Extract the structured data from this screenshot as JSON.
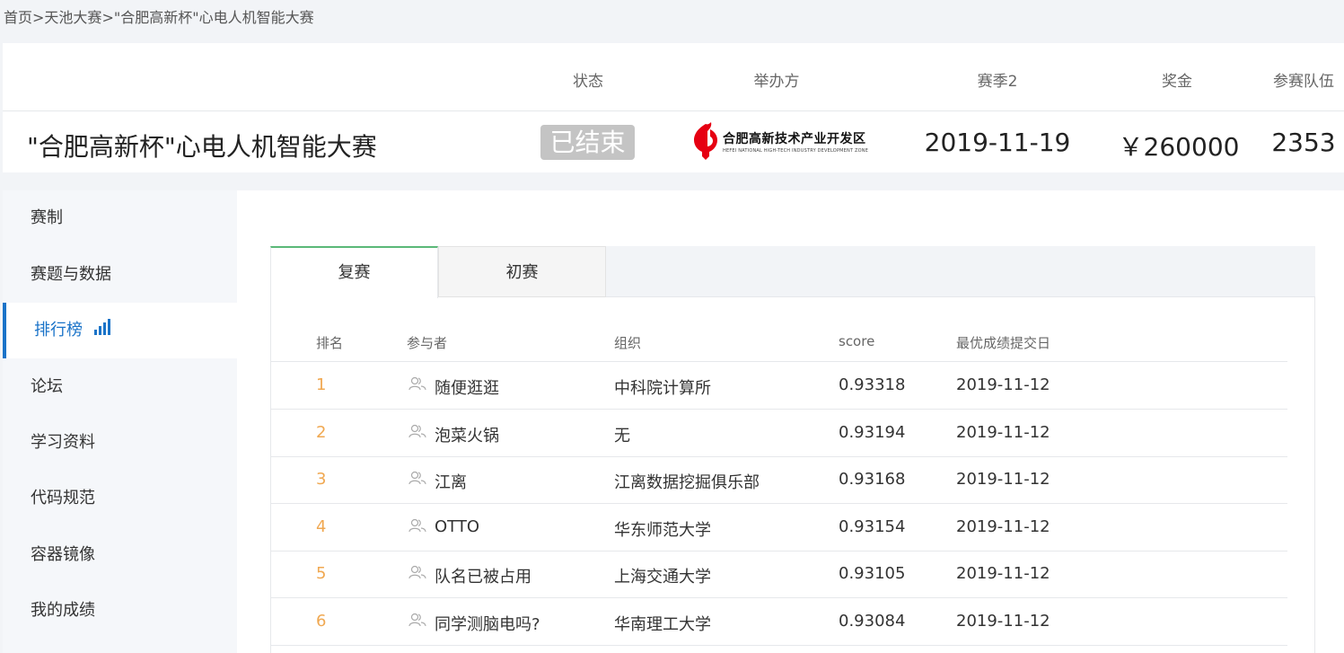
{
  "breadcrumb": {
    "home": "首页",
    "sep1": ">",
    "tianchi": "天池大赛",
    "sep2": ">",
    "current": "\"合肥高新杯\"心电人机智能大赛"
  },
  "header": {
    "labels": {
      "status": "状态",
      "organizer": "举办方",
      "season": "赛季2",
      "prize": "奖金",
      "teams": "参赛队伍"
    },
    "title": "\"合肥高新杯\"心电人机智能大赛",
    "status": "已结束",
    "organizer_name": "合肥高新技术产业开发区",
    "organizer_sub": "HEFEI NATIONAL HIGH-TECH INDUSTRY DEVELOPMENT ZONE",
    "season_date": "2019-11-19",
    "prize": "￥260000",
    "teams": "2353"
  },
  "sidebar": {
    "items": [
      {
        "label": "赛制"
      },
      {
        "label": "赛题与数据"
      },
      {
        "label": "排行榜"
      },
      {
        "label": "论坛"
      },
      {
        "label": "学习资料"
      },
      {
        "label": "代码规范"
      },
      {
        "label": "容器镜像"
      },
      {
        "label": "我的成绩"
      }
    ]
  },
  "tabs": [
    {
      "label": "复赛"
    },
    {
      "label": "初赛"
    }
  ],
  "table": {
    "headers": {
      "rank": "排名",
      "participant": "参与者",
      "org": "组织",
      "score": "score",
      "date": "最优成绩提交日"
    },
    "rows": [
      {
        "rank": "1",
        "participant": "随便逛逛",
        "org": "中科院计算所",
        "score": "0.93318",
        "date": "2019-11-12"
      },
      {
        "rank": "2",
        "participant": "泡菜火锅",
        "org": "无",
        "score": "0.93194",
        "date": "2019-11-12"
      },
      {
        "rank": "3",
        "participant": "江离",
        "org": "江离数据挖掘俱乐部",
        "score": "0.93168",
        "date": "2019-11-12"
      },
      {
        "rank": "4",
        "participant": "OTTO",
        "org": "华东师范大学",
        "score": "0.93154",
        "date": "2019-11-12"
      },
      {
        "rank": "5",
        "participant": "队名已被占用",
        "org": "上海交通大学",
        "score": "0.93105",
        "date": "2019-11-12"
      },
      {
        "rank": "6",
        "participant": "同学测脑电吗?",
        "org": "华南理工大学",
        "score": "0.93084",
        "date": "2019-11-12"
      }
    ]
  },
  "colors": {
    "accent": "#1a73c8",
    "rank": "#f0a851",
    "tab_active": "#5bb878",
    "badge": "#c4c4c4",
    "logo_red": "#e60012"
  },
  "icons": {
    "rank_nav": "bar-chart-icon",
    "participant": "user-group-icon",
    "org_logo": "hefei-hightech-logo"
  }
}
